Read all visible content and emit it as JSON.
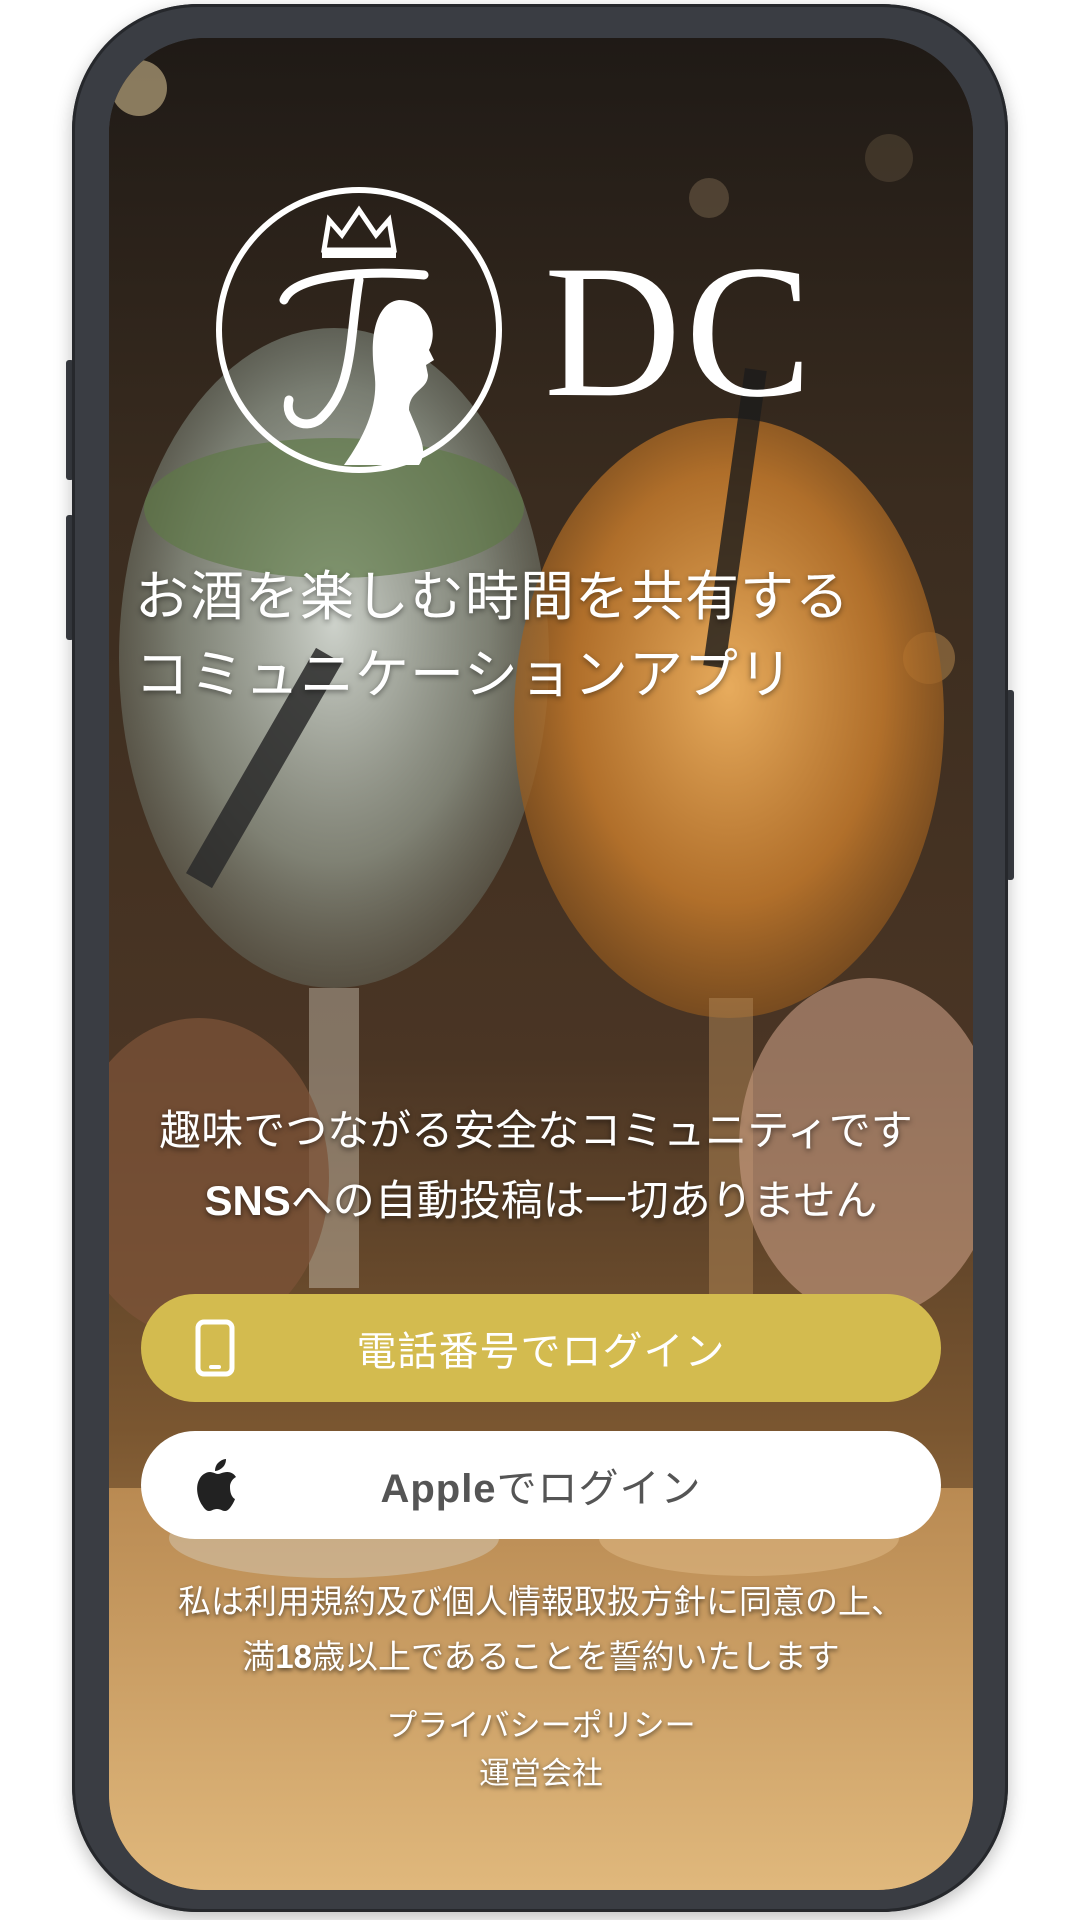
{
  "brand": {
    "name": "DC"
  },
  "tagline": {
    "line1": "お酒を楽しむ時間を共有する",
    "line2": "コミュニケーションアプリ"
  },
  "description": {
    "line1": "趣味でつながる安全なコミュニティです",
    "line2_bold": "SNS",
    "line2_rest": "への自動投稿は一切ありません"
  },
  "buttons": {
    "phone_login": {
      "label": "電話番号でログイン",
      "icon": "smartphone-icon",
      "color": "#d3bb4f"
    },
    "apple_login": {
      "label_bold": "Apple",
      "label_rest": "でログイン",
      "icon": "apple-icon",
      "color": "#ffffff"
    }
  },
  "agreement": {
    "line1": "私は利用規約及び個人情報取扱方針に同意の上、",
    "line2_prefix": "満",
    "line2_bold": "18",
    "line2_rest": "歳以上であることを誓約いたします"
  },
  "links": {
    "privacy_policy": "プライバシーポリシー",
    "operator": "運営会社"
  }
}
